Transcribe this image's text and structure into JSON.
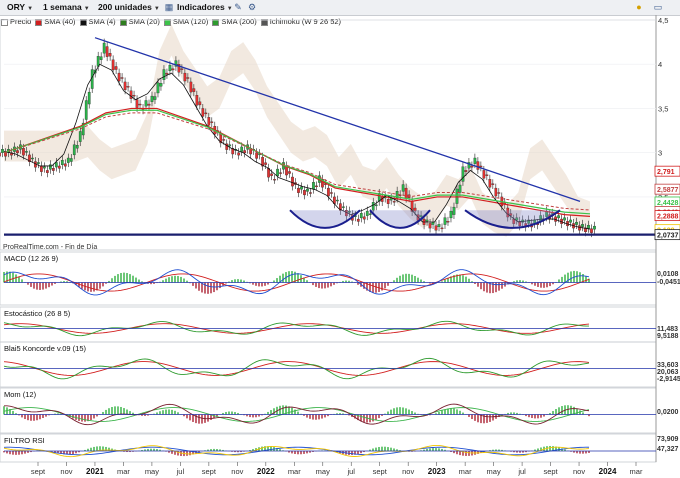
{
  "toolbar": {
    "symbol": "ORY",
    "period": "1 semana",
    "units": "200 unidades",
    "indicators_button": "Indicadores"
  },
  "legend": [
    {
      "label": "Precio",
      "color": "#ffffff"
    },
    {
      "label": "SMA (40)",
      "color": "#d21f1f"
    },
    {
      "label": "SMA (4)",
      "color": "#111111"
    },
    {
      "label": "SMA (20)",
      "color": "#2e7d1e"
    },
    {
      "label": "SMA (120)",
      "color": "#3cc24a"
    },
    {
      "label": "SMA (200)",
      "color": "#2e9b2e"
    },
    {
      "label": "Ichimoku (W 9 26 52)",
      "color": "#555555"
    }
  ],
  "source_label": "ProRealTime.com - Fin de Día",
  "panes": {
    "macd": "MACD (12 26 9)",
    "stoch": "Estocástico (26 8 5)",
    "koncorde": "Blai5 Koncorde v.09 (15)",
    "mom": "Mom (12)",
    "rsi": "FILTRO RSI"
  },
  "price_tags": [
    {
      "text": "2,791",
      "color": "#d21f1f",
      "value": 2.791
    },
    {
      "text": "2,5877",
      "color": "#c04040",
      "value": 2.5877
    },
    {
      "text": "2,4428",
      "color": "#3cc24a",
      "value": 2.4428
    },
    {
      "text": "2,3349",
      "color": "#c04040",
      "value": 2.3349
    },
    {
      "text": "2,2888",
      "color": "#d21f1f",
      "value": 2.2888
    },
    {
      "text": "2,130",
      "color": "#f2c500",
      "value": 2.13
    },
    {
      "text": "2,0737",
      "color": "#222222",
      "value": 2.0737
    }
  ],
  "sub_tags": {
    "macd": [
      "0,0108",
      "-0,0451"
    ],
    "stoch": [
      "11,483",
      "9,5188"
    ],
    "koncorde": [
      "33,603",
      "20,063",
      "-2,9145"
    ],
    "mom": [
      "0,0200"
    ],
    "rsi": [
      "73,909",
      "47,327"
    ]
  },
  "chart_data": {
    "type": "candlestick",
    "symbol": "ORY",
    "y_ticks": [
      "4,5",
      "4",
      "3,5",
      "3",
      "2,5"
    ],
    "ylim": [
      1.9,
      4.5
    ],
    "x_ticks": [
      {
        "label": "sept",
        "bold": false
      },
      {
        "label": "nov",
        "bold": false
      },
      {
        "label": "2021",
        "bold": true
      },
      {
        "label": "mar",
        "bold": false
      },
      {
        "label": "may",
        "bold": false
      },
      {
        "label": "jul",
        "bold": false
      },
      {
        "label": "sept",
        "bold": false
      },
      {
        "label": "nov",
        "bold": false
      },
      {
        "label": "2022",
        "bold": true
      },
      {
        "label": "mar",
        "bold": false
      },
      {
        "label": "may",
        "bold": false
      },
      {
        "label": "jul",
        "bold": false
      },
      {
        "label": "sept",
        "bold": false
      },
      {
        "label": "nov",
        "bold": false
      },
      {
        "label": "2023",
        "bold": true
      },
      {
        "label": "mar",
        "bold": false
      },
      {
        "label": "may",
        "bold": false
      },
      {
        "label": "jul",
        "bold": false
      },
      {
        "label": "sept",
        "bold": false
      },
      {
        "label": "nov",
        "bold": false
      },
      {
        "label": "2024",
        "bold": true
      },
      {
        "label": "mar",
        "bold": false
      }
    ],
    "close_path": [
      3.0,
      3.05,
      2.9,
      2.8,
      2.85,
      2.9,
      3.2,
      3.9,
      4.2,
      3.9,
      3.7,
      3.5,
      3.6,
      3.9,
      4.0,
      3.8,
      3.5,
      3.3,
      3.1,
      3.0,
      3.05,
      2.95,
      2.7,
      2.85,
      2.6,
      2.55,
      2.7,
      2.5,
      2.35,
      2.25,
      2.3,
      2.5,
      2.45,
      2.6,
      2.3,
      2.2,
      2.15,
      2.3,
      2.8,
      2.9,
      2.7,
      2.5,
      2.25,
      2.2,
      2.2,
      2.3,
      2.25,
      2.2,
      2.15,
      2.13
    ],
    "sma40": [
      3.0,
      3.1,
      3.2,
      3.3,
      3.45,
      3.5,
      3.5,
      3.4,
      3.3,
      3.15,
      3.0,
      2.85,
      2.75,
      2.6,
      2.55,
      2.5,
      2.45,
      2.5,
      2.5,
      2.45,
      2.4,
      2.35,
      2.3,
      2.28
    ],
    "resistance_line": [
      [
        4.3,
        0
      ],
      [
        2.45,
        1
      ]
    ],
    "support_level": 2.0737
  }
}
